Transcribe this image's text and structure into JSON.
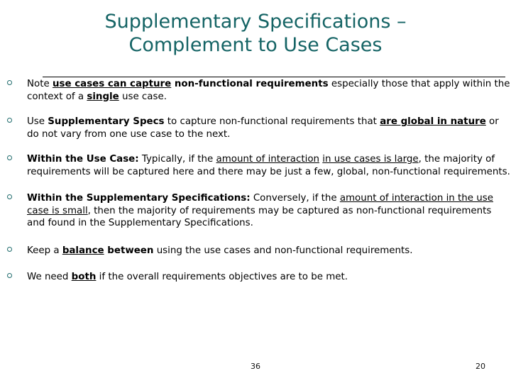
{
  "slide": {
    "background_color": "#FFFFFF",
    "title_color": "#156465",
    "body_color": "#000000",
    "bullet_marker_color": "#1F6B6C",
    "bullet_marker_glyph": "o"
  },
  "title": {
    "line1": "Supplementary Specifications –",
    "line2": "Complement to Use Cases",
    "full": "Supplementary Specifications – Complement to Use Cases"
  },
  "bullets": [
    {
      "id": 1,
      "plain": "Note use cases can capture non-functional requirements especially those that apply within the context of a single use case.",
      "segments": [
        {
          "text": "Note ",
          "style": "normal"
        },
        {
          "text": "use cases can capture",
          "style": "bold-underline"
        },
        {
          "text": " non-functional requirements",
          "style": "bold"
        },
        {
          "text": " especially those that apply within the context of a ",
          "style": "normal"
        },
        {
          "text": "single",
          "style": "bold-underline"
        },
        {
          "text": " use case.",
          "style": "normal"
        }
      ]
    },
    {
      "id": 2,
      "plain": "Use Supplementary Specs to capture non-functional requirements that are global in nature or do not vary from one use case to the next.",
      "segments": [
        {
          "text": "Use ",
          "style": "normal"
        },
        {
          "text": "Supplementary Specs",
          "style": "bold"
        },
        {
          "text": " to capture non-functional requirements that ",
          "style": "normal"
        },
        {
          "text": "are global in nature",
          "style": "bold-underline"
        },
        {
          "text": " or do not vary from one use case to the next.",
          "style": "normal"
        }
      ]
    },
    {
      "id": 3,
      "plain": "Within the Use Case:  Typically, if the amount of interaction in use cases is large, the majority of requirements will be captured here and there may be just a few, global, non-functional requirements.",
      "segments": [
        {
          "text": "Within the Use Case:",
          "style": "bold"
        },
        {
          "text": "  Typically, if the ",
          "style": "normal"
        },
        {
          "text": "amount of interaction",
          "style": "underline"
        },
        {
          "text": " ",
          "style": "normal"
        },
        {
          "text": "in use cases is large",
          "style": "underline"
        },
        {
          "text": ", the majority of requirements will be captured here and there may be just a few, global, non-functional requirements.",
          "style": "normal"
        }
      ]
    },
    {
      "id": 4,
      "plain": "Within the Supplementary Specifications: Conversely, if the amount of interaction in the use case is small, then the majority of requirements may be captured as non-functional requirements and found in the Supplementary Specifications.",
      "segments": [
        {
          "text": "Within the Supplementary Specifications:",
          "style": "bold"
        },
        {
          "text": " Conversely, if the ",
          "style": "normal"
        },
        {
          "text": "amount of interaction in the use case is small",
          "style": "underline"
        },
        {
          "text": ", then the majority of requirements may be captured as non-functional requirements and found in the Supplementary Specifications.",
          "style": "normal"
        }
      ]
    },
    {
      "id": 5,
      "plain": "Keep a balance between using the use cases and non-functional requirements.",
      "segments": [
        {
          "text": "Keep a ",
          "style": "normal"
        },
        {
          "text": "balance",
          "style": "bold-underline"
        },
        {
          "text": " between",
          "style": "bold"
        },
        {
          "text": " using the use cases and non-functional requirements.",
          "style": "normal"
        }
      ]
    },
    {
      "id": 6,
      "plain": "We need both if the overall requirements objectives are to be met.",
      "segments": [
        {
          "text": "We need ",
          "style": "normal"
        },
        {
          "text": "both",
          "style": "bold-underline"
        },
        {
          "text": " if the overall requirements objectives are to be met.",
          "style": "normal"
        }
      ]
    }
  ],
  "footer": {
    "center_number": "36",
    "right_number": "20"
  }
}
